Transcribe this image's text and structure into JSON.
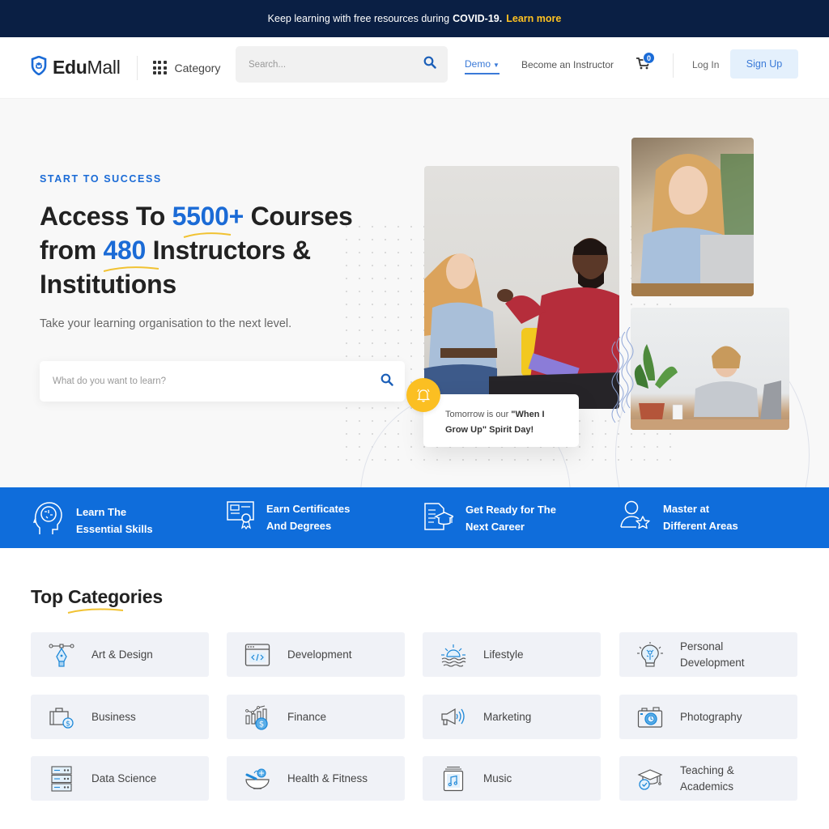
{
  "banner": {
    "text": "Keep learning with free resources during",
    "highlight": "COVID-19.",
    "link": "Learn more",
    "link_color": "#ffc221",
    "background": "#0a1f44"
  },
  "header": {
    "logo_bold": "Edu",
    "logo_regular": "Mall",
    "category_label": "Category",
    "search_placeholder": "Search...",
    "nav": {
      "demo": "Demo",
      "become_instructor": "Become an Instructor"
    },
    "cart_count": "0",
    "login": "Log In",
    "signup": "Sign Up",
    "accent": "#1b6bd6"
  },
  "hero": {
    "eyebrow": "START TO SUCCESS",
    "headline": {
      "part1": "Access To ",
      "num1": "5500+",
      "part2": " Courses from ",
      "num2": "480",
      "part3": " Instructors & Institutions"
    },
    "subtitle": "Take your learning organisation to the next level.",
    "search_placeholder": "What do you want to learn?",
    "notification": {
      "prefix": "Tomorrow is our ",
      "bold": "\"When I Grow Up\" Spirit Day!"
    }
  },
  "features": [
    {
      "icon": "brain-head-icon",
      "line1": "Learn The",
      "line2": "Essential Skills"
    },
    {
      "icon": "certificate-icon",
      "line1": "Earn Certificates",
      "line2": "And Degrees"
    },
    {
      "icon": "career-document-icon",
      "line1": "Get Ready for The",
      "line2": "Next Career"
    },
    {
      "icon": "user-star-icon",
      "line1": "Master at",
      "line2": "Different Areas"
    }
  ],
  "categories": {
    "title_prefix": "Top ",
    "title_underlined": "Categories",
    "items": [
      {
        "label": "Art & Design",
        "icon": "pen-tool-icon"
      },
      {
        "label": "Development",
        "icon": "code-window-icon"
      },
      {
        "label": "Lifestyle",
        "icon": "sunrise-icon"
      },
      {
        "label": "Personal Development",
        "icon": "lightbulb-head-icon"
      },
      {
        "label": "Business",
        "icon": "briefcase-dollar-icon"
      },
      {
        "label": "Finance",
        "icon": "chart-dollar-icon"
      },
      {
        "label": "Marketing",
        "icon": "megaphone-icon"
      },
      {
        "label": "Photography",
        "icon": "camera-icon"
      },
      {
        "label": "Data Science",
        "icon": "server-icon"
      },
      {
        "label": "Health & Fitness",
        "icon": "mortar-pestle-icon"
      },
      {
        "label": "Music",
        "icon": "music-album-icon"
      },
      {
        "label": "Teaching & Academics",
        "icon": "graduation-cap-icon"
      }
    ]
  }
}
